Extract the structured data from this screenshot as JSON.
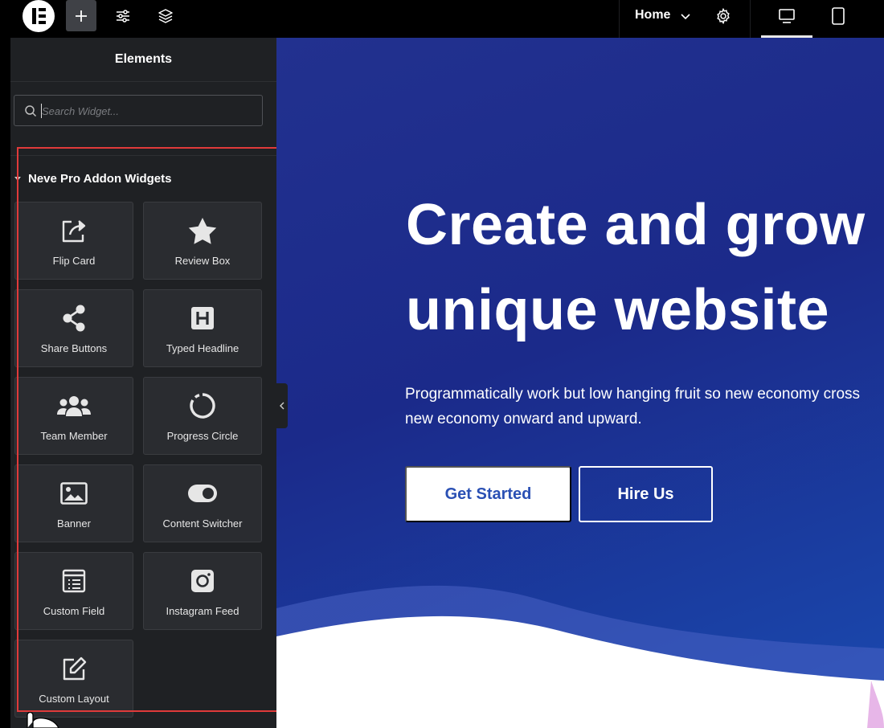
{
  "topbar": {
    "page_selector": "Home",
    "icons": [
      "elementor-logo-icon",
      "plus-icon",
      "sliders-icon",
      "layers-icon",
      "chevron-down-icon",
      "gear-icon",
      "desktop-icon",
      "tablet-icon"
    ]
  },
  "panel": {
    "title": "Elements",
    "search_placeholder": "Search Widget...",
    "section_label": "Neve Pro Addon Widgets",
    "widgets": [
      {
        "label": "Flip Card",
        "icon": "flip-card-icon"
      },
      {
        "label": "Review Box",
        "icon": "star-icon"
      },
      {
        "label": "Share Buttons",
        "icon": "share-icon"
      },
      {
        "label": "Typed Headline",
        "icon": "headline-h-icon"
      },
      {
        "label": "Team Member",
        "icon": "users-icon"
      },
      {
        "label": "Progress Circle",
        "icon": "progress-circle-icon"
      },
      {
        "label": "Banner",
        "icon": "image-icon"
      },
      {
        "label": "Content Switcher",
        "icon": "toggle-icon"
      },
      {
        "label": "Custom Field",
        "icon": "custom-field-icon"
      },
      {
        "label": "Instagram Feed",
        "icon": "instagram-icon"
      },
      {
        "label": "Custom Layout",
        "icon": "edit-icon"
      }
    ]
  },
  "preview": {
    "title_line1": "Create and grow",
    "title_line2": "unique website",
    "subtitle_line1": "Programmatically work but low hanging fruit so new economy cross",
    "subtitle_line2": "new economy onward and upward.",
    "primary_button": "Get Started",
    "secondary_button": "Hire Us"
  },
  "colors": {
    "panel_bg": "#1f2124",
    "widget_bg": "#2a2c30",
    "highlight": "#e03a3a",
    "hero_blue": "#1b2a8a",
    "button_text": "#2a50b4"
  }
}
